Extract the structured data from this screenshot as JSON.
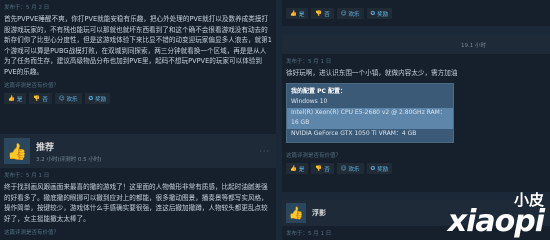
{
  "left": {
    "review1": {
      "posted": "发布于：5 月 2 日",
      "text": "首先PVPVE睡醒不爽，你打PVE就能安稳有乐趣，把心外处理的PVE就打以及数养成类摸打股游戏玩家的，不有残也能玩可以那就也就坏东西看到了和这个确不会很看游戏没有动去的新存们你了比型心分度性，但是这游戏体验下来比显不错的动变迎玩家偏显多人浪去，就第1个游戏可以算是PUBG战模打败，在双城到同探索，两三分钟就看换一个区域，再是是从人为了任务而生存，建议高级物品分布也加到PVE里，起码不想玩PVPVE的玩家可以体验到PVE的乐趣。",
      "helpful_q": "这篇评测是否有价值？",
      "yes": "是",
      "no": "否",
      "funny": "欢乐",
      "award": "奖励"
    },
    "review2": {
      "title": "推荐",
      "hours": "3.2 小时(评测时 0.5 小时)",
      "posted": "发布于：5 月 1 日",
      "text": "终于找到画风跟画面来最喜的撤的游戏了！这里面的人物做形非常有质感，比起时油腻差强的好看多了。撤底撤的眼挪可以撤到应对上的都能，很多撤动图景，播奏景等都写实风格，操作简单，按键较少，游戏体什么手感确实要很强，连这后撤加撤蹲，人物较头都更乱点较好了，女主挺能撤太太棒了。",
      "helpful_q": "这篇评测是否有价值？"
    }
  },
  "right": {
    "top_buttons": {
      "yes": "是",
      "no": "否",
      "funny": "欢乐",
      "award": "奖励"
    },
    "review3": {
      "hours": "19.1 小时",
      "posted": "发布于：5 月 1 日",
      "text": "徐好玩啊，进认识东围一个小镇，就做内容太少，需方加油",
      "specs": {
        "title": "我的配置 PC 配置：",
        "os": "Windows 10",
        "cpu": "Intel(R) Xeon(R) CPU E5-2680 v2 @ 2.80GHz  RAM：16 GB",
        "gpu": "NVIDIA GeForce GTX 1050 Ti  VRAM：4 GB"
      },
      "helpful_q": "这篇评测是否有价值？",
      "yes": "是",
      "no": "否",
      "funny": "欢乐",
      "award": "奖励"
    },
    "review4": {
      "user": "浮影",
      "posted": "发布于：5 月 1 日"
    },
    "watermark": {
      "cn": "小皮",
      "en": "xiaopi",
      "domain": "com"
    }
  }
}
